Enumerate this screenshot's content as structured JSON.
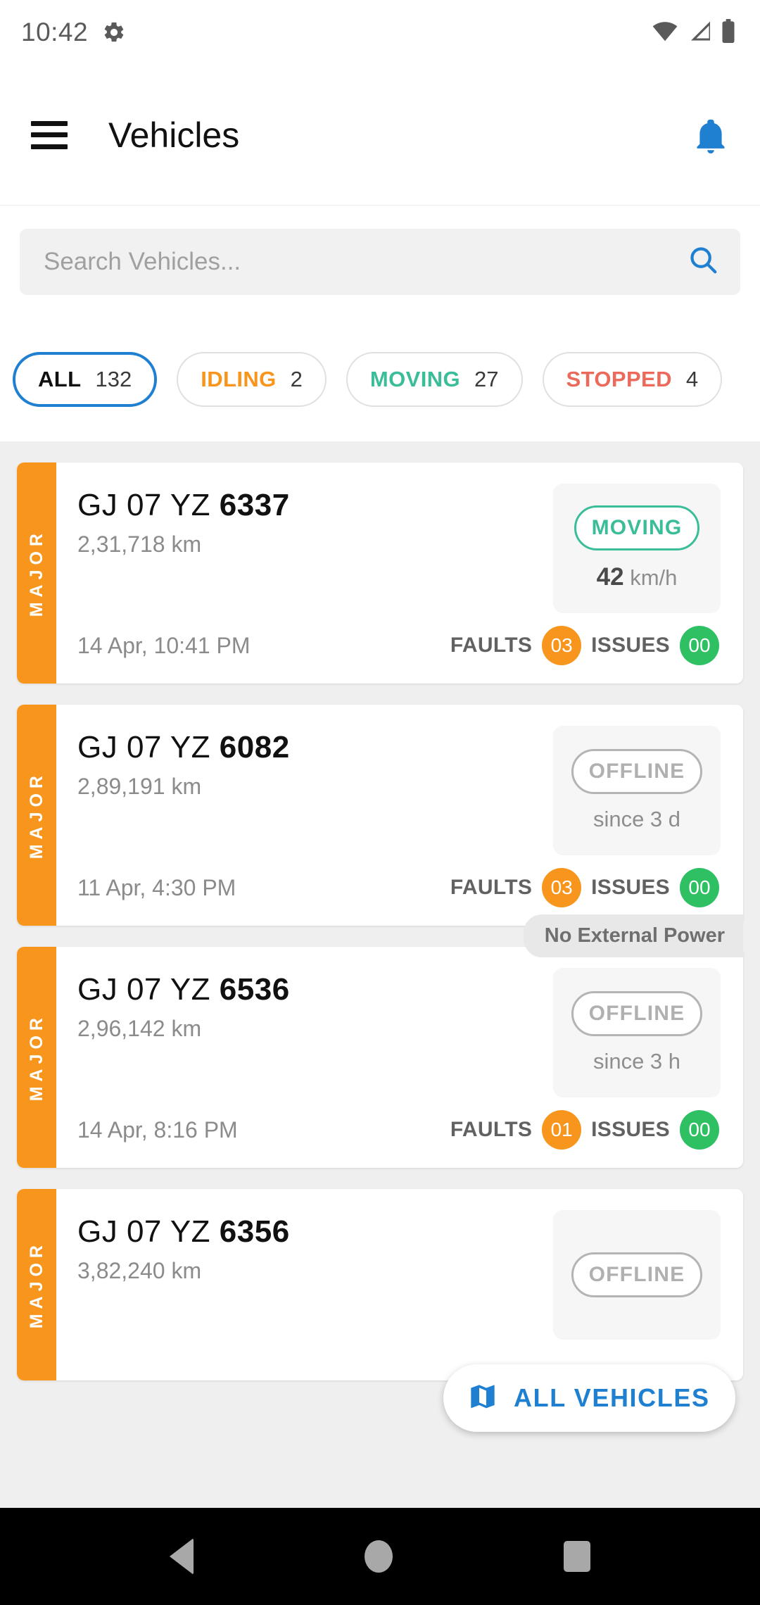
{
  "status_bar": {
    "time": "10:42",
    "icons": [
      "gear-icon",
      "wifi-icon",
      "cellular-signal-icon",
      "battery-icon"
    ]
  },
  "app_bar": {
    "menu_icon": "hamburger-menu-icon",
    "title": "Vehicles",
    "notification_icon": "bell-icon",
    "accent_color": "#1f7fd0"
  },
  "search": {
    "placeholder": "Search Vehicles...",
    "value": "",
    "icon": "search-icon"
  },
  "filters": {
    "selected": "ALL",
    "chips": [
      {
        "label": "ALL",
        "count": "132",
        "color": "#111111",
        "selected": true
      },
      {
        "label": "IDLING",
        "count": "2",
        "color": "#f7951d",
        "selected": false
      },
      {
        "label": "MOVING",
        "count": "27",
        "color": "#3bbd99",
        "selected": false
      },
      {
        "label": "STOPPED",
        "count": "4",
        "color": "#ec6a5c",
        "selected": false
      }
    ]
  },
  "vehicles": [
    {
      "severity": "MAJOR",
      "severity_color": "#f7951d",
      "plate_prefix": "GJ 07 YZ ",
      "plate_number": "6337",
      "odometer": "2,31,718 km",
      "status": "MOVING",
      "status_color": "#3bbd99",
      "speed_value": "42",
      "speed_unit": "km/h",
      "timestamp": "14 Apr, 10:41 PM",
      "faults_label": "FAULTS",
      "faults_count": "03",
      "issues_label": "ISSUES",
      "issues_count": "00",
      "power_badge": null
    },
    {
      "severity": "MAJOR",
      "severity_color": "#f7951d",
      "plate_prefix": "GJ 07 YZ ",
      "plate_number": "6082",
      "odometer": "2,89,191 km",
      "status": "OFFLINE",
      "status_color": "#b0b0b0",
      "since": "since 3 d",
      "timestamp": "11 Apr, 4:30 PM",
      "faults_label": "FAULTS",
      "faults_count": "03",
      "issues_label": "ISSUES",
      "issues_count": "00",
      "power_badge": null
    },
    {
      "severity": "MAJOR",
      "severity_color": "#f7951d",
      "plate_prefix": "GJ 07 YZ ",
      "plate_number": "6536",
      "odometer": "2,96,142 km",
      "status": "OFFLINE",
      "status_color": "#b0b0b0",
      "since": "since 3 h",
      "timestamp": "14 Apr, 8:16 PM",
      "faults_label": "FAULTS",
      "faults_count": "01",
      "issues_label": "ISSUES",
      "issues_count": "00",
      "power_badge": "No External Power"
    },
    {
      "severity": "MAJOR",
      "severity_color": "#f7951d",
      "plate_prefix": "GJ 07 YZ ",
      "plate_number": "6356",
      "odometer": "3,82,240 km",
      "status": "OFFLINE",
      "status_color": "#b0b0b0",
      "since": "",
      "timestamp": "",
      "faults_label": "",
      "faults_count": "",
      "issues_label": "",
      "issues_count": "",
      "power_badge": null
    }
  ],
  "fab": {
    "label": "ALL VEHICLES",
    "icon": "map-icon",
    "color": "#1f7fd0"
  },
  "nav_bar": {
    "back": "back-triangle-icon",
    "home": "home-circle-icon",
    "recents": "recents-square-icon"
  }
}
